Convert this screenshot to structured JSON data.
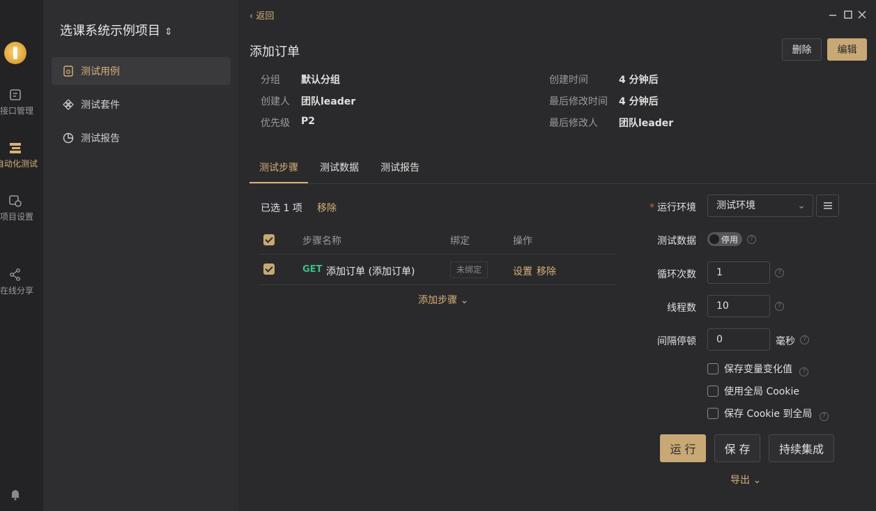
{
  "rail": {
    "items": [
      {
        "label": "接口管理",
        "icon": "api-icon"
      },
      {
        "label": "自动化测试",
        "icon": "automation-icon"
      },
      {
        "label": "项目设置",
        "icon": "settings-icon"
      },
      {
        "label": "在线分享",
        "icon": "share-icon"
      }
    ]
  },
  "sidebar": {
    "project_title": "选课系统示例项目",
    "caret": "⌃⌄",
    "items": [
      {
        "label": "测试用例",
        "active": true
      },
      {
        "label": "测试套件"
      },
      {
        "label": "测试报告"
      }
    ]
  },
  "header": {
    "back_label": "‹ 返回",
    "title": "添加订单",
    "delete_label": "删除",
    "edit_label": "编辑"
  },
  "meta": {
    "group_key": "分组",
    "group_val": "默认分组",
    "creator_key": "创建人",
    "creator_val": "团队leader",
    "priority_key": "优先级",
    "priority_val": "P2",
    "created_key": "创建时间",
    "created_val": "4 分钟后",
    "modified_key": "最后修改时间",
    "modified_val": "4 分钟后",
    "modifier_key": "最后修改人",
    "modifier_val": "团队leader"
  },
  "tabs": [
    "测试步骤",
    "测试数据",
    "测试报告"
  ],
  "steps": {
    "selected_text": "已选 1 项",
    "remove_label": "移除",
    "columns": {
      "name": "步骤名称",
      "binding": "绑定",
      "actions": "操作"
    },
    "rows": [
      {
        "method": "GET",
        "name": "添加订单 (添加订单)",
        "binding": "未绑定",
        "settings": "设置",
        "remove": "移除"
      }
    ],
    "add_label": "添加步骤 ⌄"
  },
  "form": {
    "env_label": "运行环境",
    "env_value": "测试环境",
    "data_label": "测试数据",
    "data_toggle": "停用",
    "loops_label": "循环次数",
    "loops_value": "1",
    "threads_label": "线程数",
    "threads_value": "10",
    "interval_label": "间隔停顿",
    "interval_value": "0",
    "interval_unit": "毫秒",
    "checks": [
      "保存变量变化值",
      "使用全局 Cookie",
      "保存 Cookie 到全局"
    ],
    "run_label": "运 行",
    "save_label": "保 存",
    "ci_label": "持续集成",
    "export_label": "导出 ⌄"
  },
  "colors": {
    "accent": "#c8a874",
    "method_get": "#3dbd8e"
  }
}
